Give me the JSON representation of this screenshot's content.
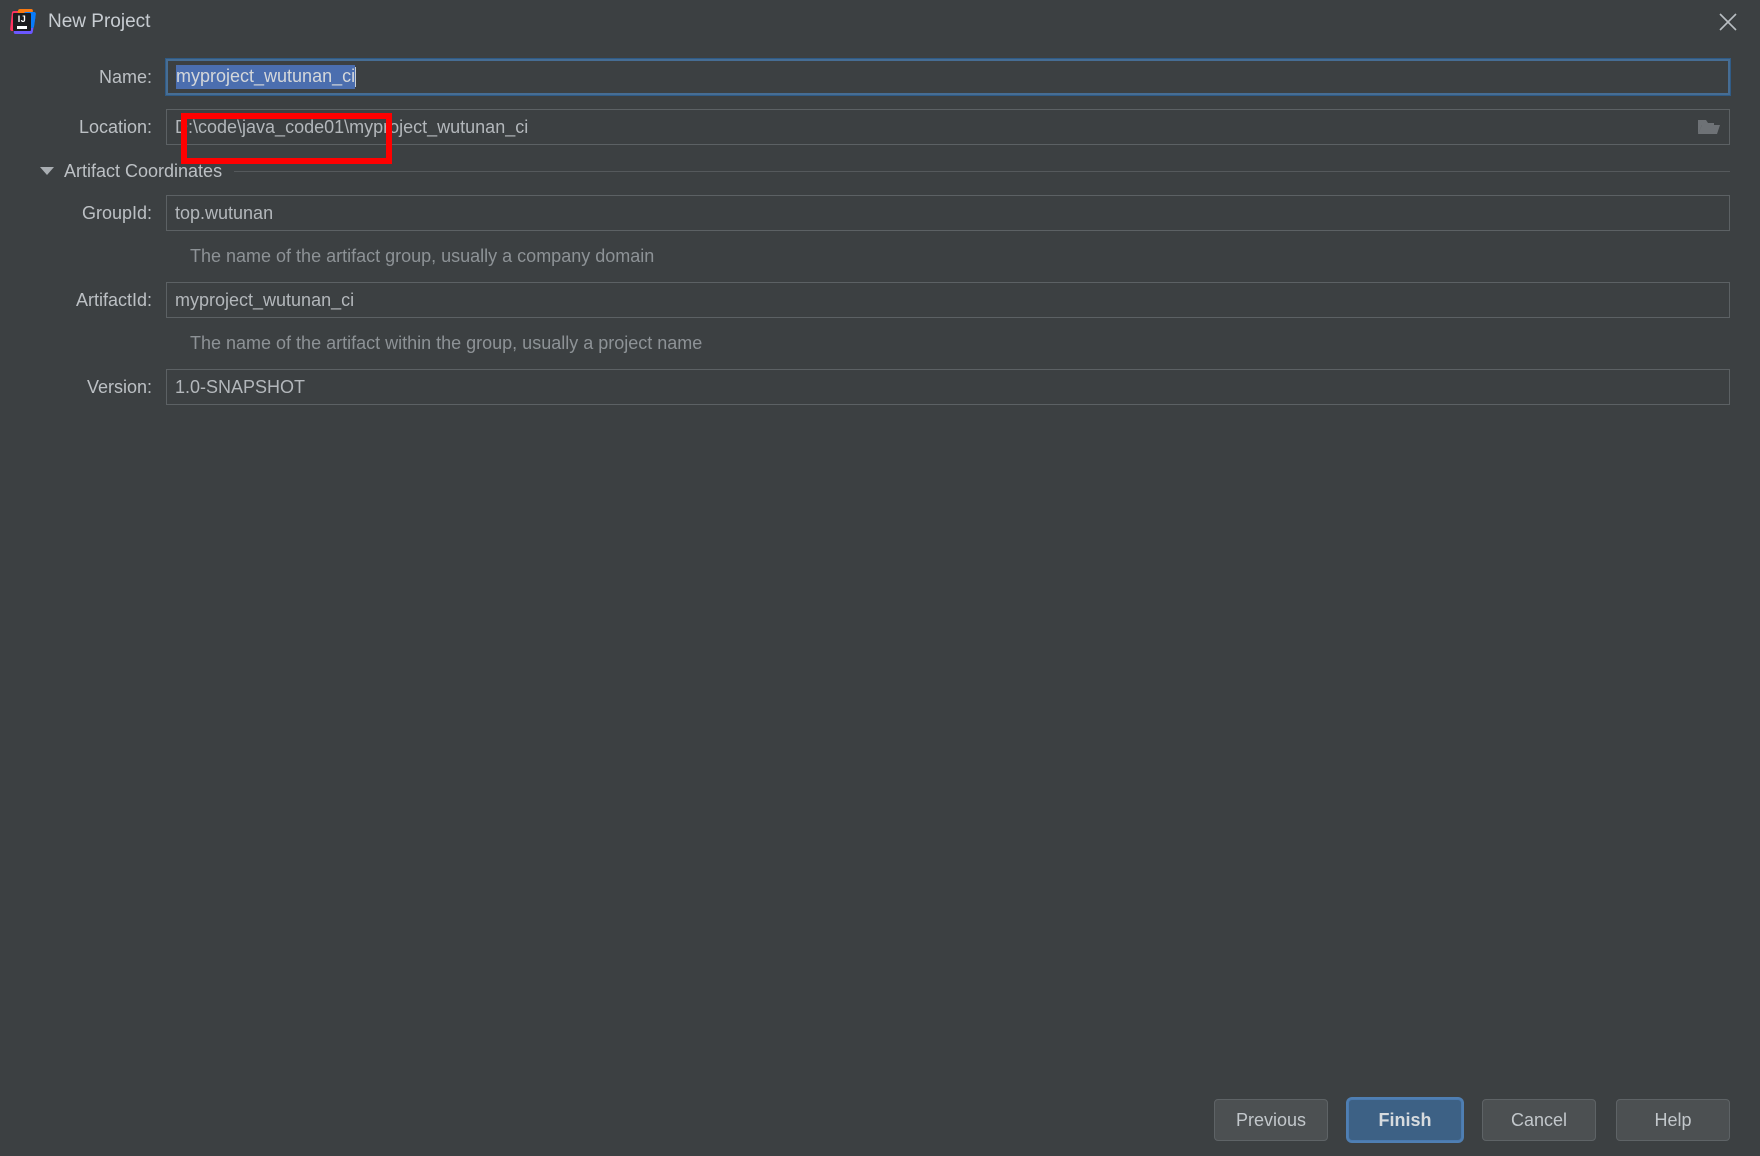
{
  "window": {
    "title": "New Project",
    "logo_icon": "intellij-idea-logo",
    "close_icon": "close-icon"
  },
  "form": {
    "name": {
      "label": "Name:",
      "value": "myproject_wutunan_ci",
      "selected": true
    },
    "location": {
      "label": "Location:",
      "value": "D:\\code\\java_code01\\myproject_wutunan_ci",
      "browse_icon": "folder-icon"
    }
  },
  "section": {
    "label": "Artifact Coordinates",
    "expanded": true,
    "collapse_icon": "chevron-down-icon"
  },
  "artifact": {
    "group_id": {
      "label": "GroupId:",
      "value": "top.wutunan",
      "hint": "The name of the artifact group, usually a company domain"
    },
    "artifact_id": {
      "label": "ArtifactId:",
      "value": "myproject_wutunan_ci",
      "hint": "The name of the artifact within the group, usually a project name"
    },
    "version": {
      "label": "Version:",
      "value": "1.0-SNAPSHOT"
    }
  },
  "annotation": {
    "color": "#ff0000",
    "target": "location-path-prefix"
  },
  "buttons": {
    "previous": "Previous",
    "finish": "Finish",
    "cancel": "Cancel",
    "help": "Help"
  },
  "colors": {
    "background": "#3c4042",
    "accent": "#3d6185",
    "selection": "#4b6eaf",
    "annotation": "#ff0000"
  }
}
